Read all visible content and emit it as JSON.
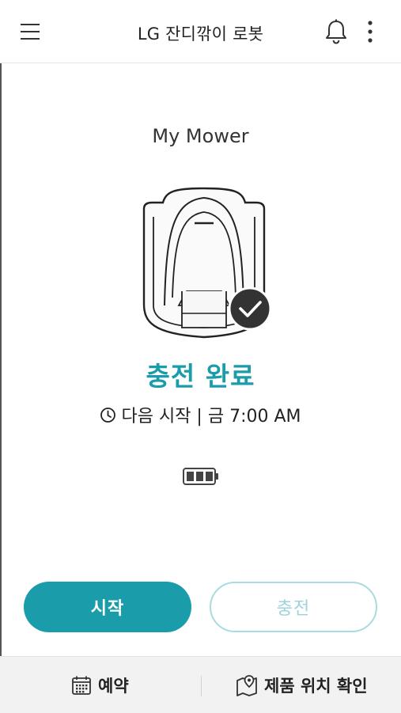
{
  "header": {
    "title": "LG 잔디깎이 로봇",
    "menu_icon": "hamburger-menu-icon",
    "bell_icon": "bell-icon",
    "more_icon": "more-vertical-icon"
  },
  "device": {
    "name": "My Mower",
    "status": "충전 완료",
    "status_color": "#1a9cab",
    "next_start_label": "다음 시작 | 금 7:00 AM",
    "battery_level": 1.0
  },
  "actions": {
    "start_label": "시작",
    "charge_label": "충전"
  },
  "bottom_bar": {
    "schedule_label": "예약",
    "location_label": "제품 위치 확인"
  }
}
